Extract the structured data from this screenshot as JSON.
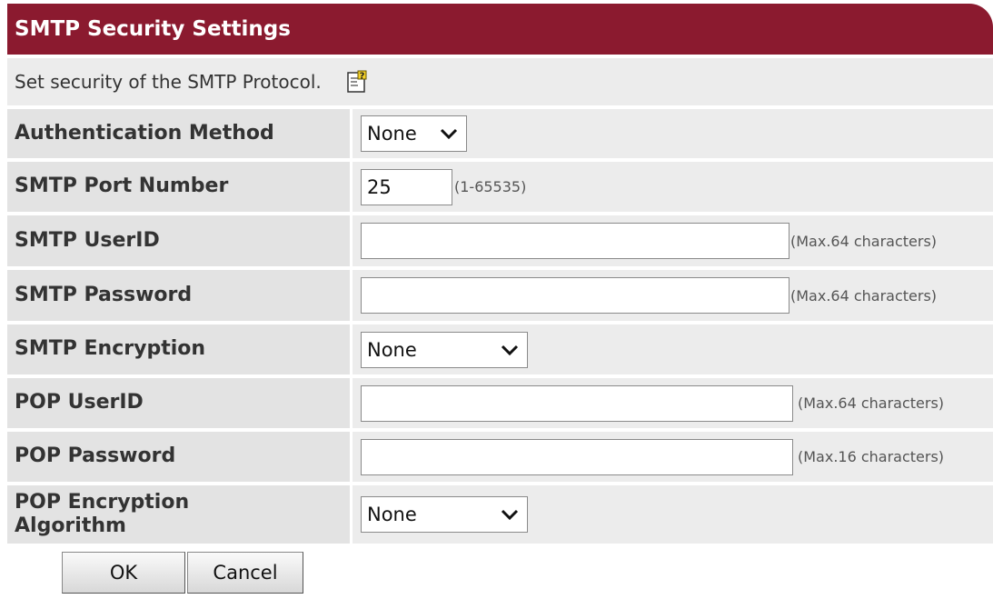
{
  "title": "SMTP Security Settings",
  "description": "Set security of the SMTP Protocol.",
  "fields": {
    "auth_method": {
      "label": "Authentication Method",
      "value": "None"
    },
    "smtp_port": {
      "label": "SMTP Port Number",
      "value": "25",
      "hint": "(1-65535)"
    },
    "smtp_userid": {
      "label": "SMTP UserID",
      "value": "",
      "hint": "(Max.64 characters)"
    },
    "smtp_password": {
      "label": "SMTP Password",
      "value": "",
      "hint": "(Max.64 characters)"
    },
    "smtp_encryption": {
      "label": "SMTP Encryption",
      "value": "None"
    },
    "pop_userid": {
      "label": "POP UserID",
      "value": "",
      "hint": "(Max.64 characters)"
    },
    "pop_password": {
      "label": "POP Password",
      "value": "",
      "hint": "(Max.16 characters)"
    },
    "pop_encryption": {
      "label": "POP Encryption Algorithm",
      "value": "None"
    }
  },
  "buttons": {
    "ok": "OK",
    "cancel": "Cancel"
  },
  "icons": {
    "help": "help-notepad-icon",
    "dropdown": "chevron-down-icon"
  },
  "colors": {
    "header": "#8b1a2f",
    "label_bg": "#e3e3e3",
    "value_bg": "#ececec"
  }
}
